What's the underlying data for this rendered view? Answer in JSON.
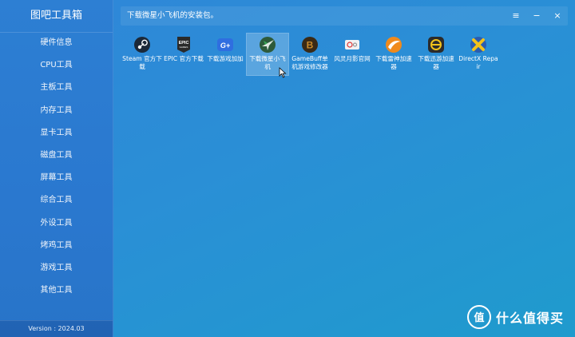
{
  "sidebar": {
    "title": "图吧工具箱",
    "items": [
      "硬件信息",
      "CPU工具",
      "主板工具",
      "内存工具",
      "显卡工具",
      "磁盘工具",
      "屏幕工具",
      "综合工具",
      "外设工具",
      "烤鸡工具",
      "游戏工具",
      "其他工具"
    ],
    "version": "Version : 2024.03"
  },
  "topbar": {
    "status": "下载微星小飞机的安装包。",
    "menu_glyph": "≡",
    "minimize_glyph": "−",
    "close_glyph": "×"
  },
  "apps": [
    {
      "label": "Steam 官方下载",
      "icon": "steam-icon",
      "color": "#1b2838"
    },
    {
      "label": "EPIC 官方下载",
      "icon": "epic-games-icon",
      "color": "#2a2a2a"
    },
    {
      "label": "下载游戏加加",
      "icon": "game-plus-icon",
      "color": "#2f6ee0"
    },
    {
      "label": "下载微星小飞机",
      "icon": "afterburner-icon",
      "color": "#3aa655"
    },
    {
      "label": "GameBuff单机游戏修改器",
      "icon": "gamebuff-icon",
      "color": "#c98a2b"
    },
    {
      "label": "风灵月影官网",
      "icon": "wemod-site-icon",
      "color": "#e8e8e8"
    },
    {
      "label": "下载雷神加速器",
      "icon": "leishen-icon",
      "color": "#f08a1c"
    },
    {
      "label": "下载迅游加速器",
      "icon": "xunyou-icon",
      "color": "#2b2b2b"
    },
    {
      "label": "DirectX Repair",
      "icon": "directx-icon",
      "color": "#f2c21b"
    }
  ],
  "watermark": {
    "text": "什么值得买",
    "logo_glyph": "值"
  }
}
